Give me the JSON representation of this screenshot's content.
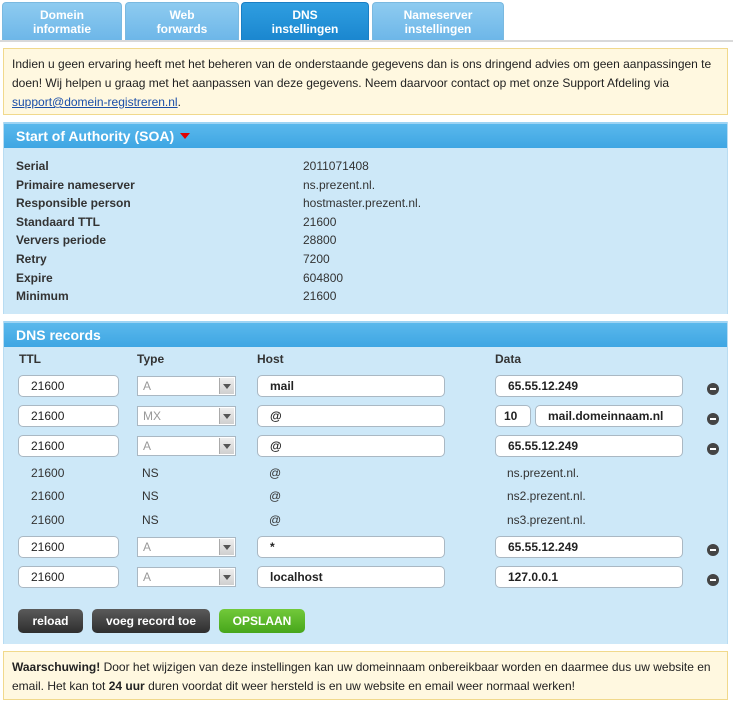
{
  "tabs": [
    {
      "line1": "Domein",
      "line2": "informatie"
    },
    {
      "line1": "Web",
      "line2": "forwards"
    },
    {
      "line1": "DNS",
      "line2": "instellingen"
    },
    {
      "line1": "Nameserver",
      "line2": "instellingen"
    }
  ],
  "active_tab": 2,
  "top_notice": {
    "text": "Indien u geen ervaring heeft met het beheren van de onderstaande gegevens dan is ons dringend advies om geen aanpassingen te doen! Wij helpen u graag met het aanpassen van deze gegevens. Neem daarvoor contact op met onze Support Afdeling via",
    "link": "support@domein-registreren.nl",
    "tail": "."
  },
  "soa": {
    "title": "Start of Authority (SOA)",
    "rows": [
      {
        "label": "Serial",
        "value": "2011071408"
      },
      {
        "label": "Primaire nameserver",
        "value": "ns.prezent.nl."
      },
      {
        "label": "Responsible person",
        "value": "hostmaster.prezent.nl."
      },
      {
        "label": "Standaard TTL",
        "value": "21600"
      },
      {
        "label": "Ververs periode",
        "value": "28800"
      },
      {
        "label": "Retry",
        "value": "7200"
      },
      {
        "label": "Expire",
        "value": "604800"
      },
      {
        "label": "Minimum",
        "value": "21600"
      }
    ]
  },
  "dns": {
    "title": "DNS records",
    "columns": {
      "ttl": "TTL",
      "type": "Type",
      "host": "Host",
      "data": "Data"
    },
    "records": [
      {
        "ttl": "21600",
        "type": "A",
        "host": "mail",
        "data": "65.55.12.249",
        "editable": true
      },
      {
        "ttl": "21600",
        "type": "MX",
        "host": "@",
        "priority": "10",
        "data": "mail.domeinnaam.nl",
        "editable": true
      },
      {
        "ttl": "21600",
        "type": "A",
        "host": "@",
        "data": "65.55.12.249",
        "editable": true
      },
      {
        "ttl": "21600",
        "type": "NS",
        "host": "@",
        "data": "ns.prezent.nl.",
        "editable": false
      },
      {
        "ttl": "21600",
        "type": "NS",
        "host": "@",
        "data": "ns2.prezent.nl.",
        "editable": false
      },
      {
        "ttl": "21600",
        "type": "NS",
        "host": "@",
        "data": "ns3.prezent.nl.",
        "editable": false
      },
      {
        "ttl": "21600",
        "type": "A",
        "host": "*",
        "data": "65.55.12.249",
        "editable": true
      },
      {
        "ttl": "21600",
        "type": "A",
        "host": "localhost",
        "data": "127.0.0.1",
        "editable": true
      }
    ],
    "buttons": {
      "reload": "reload",
      "add": "voeg record toe",
      "save": "OPSLAAN"
    }
  },
  "bottom_notice": {
    "strong": "Waarschuwing!",
    "text1": " Door het wijzigen van deze instellingen kan uw domeinnaam onbereikbaar worden en daarmee dus uw website en email. Het kan tot ",
    "strong2": "24 uur",
    "text2": " duren voordat dit weer hersteld is en uw website en email weer normaal werken!"
  },
  "colors": {
    "tab_active": "#1a86cf",
    "tab": "#7cc0ec",
    "panel": "#cde8f8",
    "save": "#47a61b"
  }
}
